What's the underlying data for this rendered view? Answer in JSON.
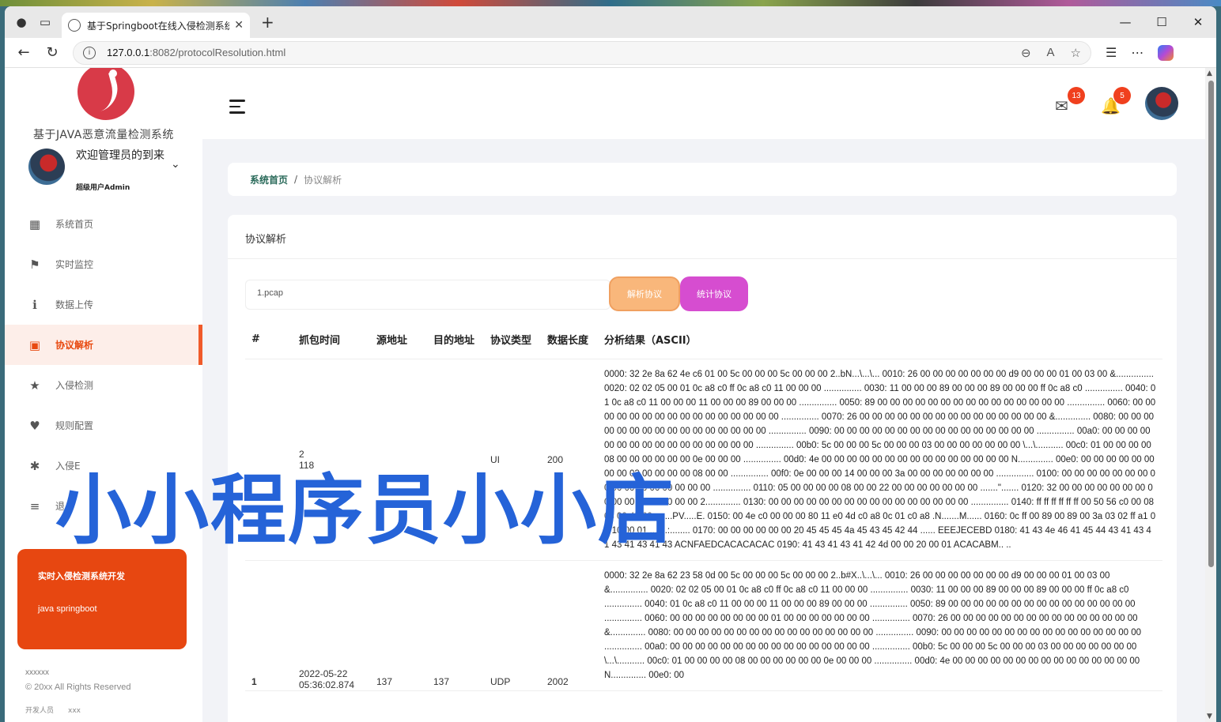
{
  "browser": {
    "tab_title": "基于Springboot在线入侵检测系统",
    "url_host": "127.0.0.1",
    "url_path": ":8082/protocolResolution.html"
  },
  "sidebar": {
    "system_name": "基于JAVA恶意流量检测系统",
    "welcome": "欢迎管理员的到来",
    "role": "超级用户Admin",
    "items": [
      {
        "label": "系统首页",
        "icon": "dashboard-icon"
      },
      {
        "label": "实时监控",
        "icon": "flag-icon"
      },
      {
        "label": "数据上传",
        "icon": "info-icon"
      },
      {
        "label": "协议解析",
        "icon": "pulse-icon",
        "active": true
      },
      {
        "label": "入侵检测",
        "icon": "star-icon"
      },
      {
        "label": "规则配置",
        "icon": "heart-icon"
      },
      {
        "label": "入侵E",
        "icon": "badge-icon"
      },
      {
        "label": "退",
        "icon": "list-icon"
      }
    ],
    "promo_title": "实时入侵检测系统开发",
    "promo_sub": "java springboot",
    "footer_line1": "xxxxxx",
    "footer_line2": "© 20xx All Rights Reserved",
    "footer_line3": "开发人员　　xxx"
  },
  "header": {
    "messages_badge": "13",
    "notifications_badge": "5"
  },
  "breadcrumb": {
    "home": "系统首页",
    "current": "协议解析"
  },
  "card": {
    "title": "协议解析",
    "file_value": "1.pcap",
    "parse_button": "解析协议",
    "stat_button": "统计协议"
  },
  "table": {
    "headers": [
      "#",
      "抓包时间",
      "源地址",
      "目的地址",
      "协议类型",
      "数据长度",
      "分析结果（ASCII）"
    ],
    "rows": [
      {
        "index": "",
        "time": "2",
        "time2": "118",
        "src": "",
        "dst": "",
        "proto": "UI",
        "len": "200",
        "result": "0000: 32 2e 8a 62 4e c6 01 00 5c 00 00 00 5c 00 00 00 2..bN...\\...\\... 0010: 26 00 00 00 00 00 00 00 d9 00 00 00 01 00 03 00 &............... 0020: 02 02 05 00 01 0c a8 c0 ff 0c a8 c0 11 00 00 00 ............... 0030: 11 00 00 00 89 00 00 00 89 00 00 00 ff 0c a8 c0 ............... 0040: 01 0c a8 c0 11 00 00 00 11 00 00 00 89 00 00 00 ............... 0050: 89 00 00 00 00 00 00 00 00 00 00 00 00 00 00 00 ............... 0060: 00 00 00 00 00 00 00 00 00 00 00 00 00 00 00 00 ............... 0070: 26 00 00 00 00 00 00 00 00 00 00 00 00 00 00 00 &.............. 0080: 00 00 00 00 00 00 00 00 00 00 00 00 00 00 00 00 ............... 0090: 00 00 00 00 00 00 00 00 00 00 00 00 00 00 00 00 ............... 00a0: 00 00 00 00 00 00 00 00 00 00 00 00 00 00 00 00 ............... 00b0: 5c 00 00 00 5c 00 00 00 03 00 00 00 00 00 00 00 \\...\\........... 00c0: 01 00 00 00 00 08 00 00 00 00 00 00 0e 00 00 00 ............... 00d0: 4e 00 00 00 00 00 00 00 00 00 00 00 00 00 00 00 N.............. 00e0: 00 00 00 00 00 00 00 00 02 00 00 00 00 08 00 00 ............... 00f0: 0e 00 00 00 14 00 00 00 3a 00 00 00 00 00 00 00 ............... 0100: 00 00 00 00 00 00 00 00 00 00 00 00 00 00 00 00 ............... 0110: 05 00 00 00 00 08 00 00 22 00 00 00 00 00 00 00 .......\"....... 0120: 32 00 00 00 00 00 00 00 00 00 00 00 00 00 00 00 2.............. 0130: 00 00 00 00 00 00 00 00 00 00 00 00 00 00 00 00 ............... 0140: ff ff ff ff ff ff 00 50 56 c0 00 08 08 00 45 00 .......PV.....E. 0150: 00 4e c0 00 00 00 80 11 e0 4d c0 a8 0c 01 c0 a8 .N.......M...... 0160: 0c ff 00 89 00 89 00 3a 03 02 ff a1 01 10 00 01 .......:........ 0170: 00 00 00 00 00 00 20 45 45 45 4a 45 43 45 42 44 ...... EEEJECEBD 0180: 41 43 4e 46 41 45 44 43 41 43 41 43 41 43 41 43 ACNFAEDCACACACAC 0190: 41 43 41 43 41 42 4d 00 00 20 00 01 ACACABM.. .."
      },
      {
        "index": "1",
        "time": "2022-05-22",
        "time2": "05:36:02.874",
        "src": "137",
        "dst": "137",
        "proto": "UDP",
        "len": "2002",
        "result": "0000: 32 2e 8a 62 23 58 0d 00 5c 00 00 00 5c 00 00 00 2..b#X..\\...\\... 0010: 26 00 00 00 00 00 00 00 d9 00 00 00 01 00 03 00 &............... 0020: 02 02 05 00 01 0c a8 c0 ff 0c a8 c0 11 00 00 00 ............... 0030: 11 00 00 00 89 00 00 00 89 00 00 00 ff 0c a8 c0 ............... 0040: 01 0c a8 c0 11 00 00 00 11 00 00 00 89 00 00 00 ............... 0050: 89 00 00 00 00 00 00 00 00 00 00 00 00 00 00 00 ............... 0060: 00 00 00 00 00 00 00 00 01 00 00 00 00 00 00 00 ............... 0070: 26 00 00 00 00 00 00 00 00 00 00 00 00 00 00 00 &.............. 0080: 00 00 00 00 00 00 00 00 00 00 00 00 00 00 00 00 ............... 0090: 00 00 00 00 00 00 00 00 00 00 00 00 00 00 00 00 ............... 00a0: 00 00 00 00 00 00 00 00 00 00 00 00 00 00 00 00 ............... 00b0: 5c 00 00 00 5c 00 00 00 03 00 00 00 00 00 00 00 \\...\\........... 00c0: 01 00 00 00 00 08 00 00 00 00 00 00 0e 00 00 00 ............... 00d0: 4e 00 00 00 00 00 00 00 00 00 00 00 00 00 00 00 N.............. 00e0: 00"
      }
    ]
  },
  "watermark": "小小程序员小小店",
  "colors": {
    "accent": "#e8490f",
    "promo": "#e74711",
    "parse_btn": "#f9b77b",
    "stat_btn": "#d64dd0",
    "watermark": "#2563d8"
  }
}
